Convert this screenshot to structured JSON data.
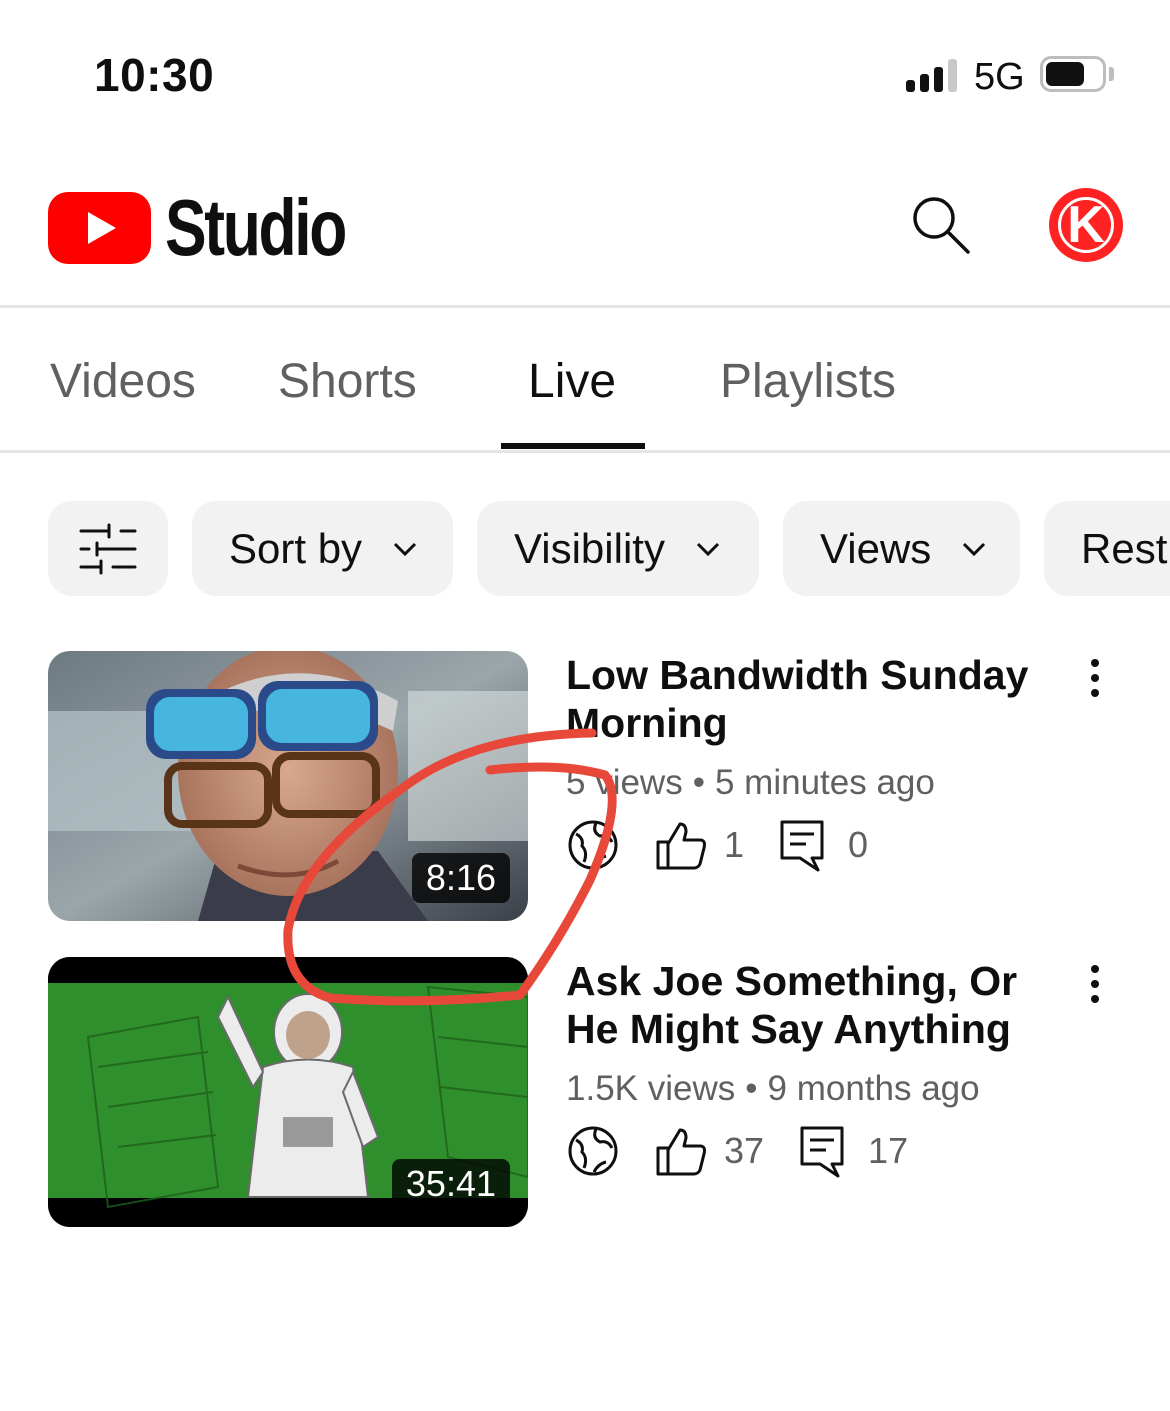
{
  "status_bar": {
    "time": "10:30",
    "network": "5G",
    "battery_level": 0.7
  },
  "header": {
    "logo_text": "Studio",
    "avatar_letter": "K",
    "brand_color": "#ff0000"
  },
  "tabs": [
    {
      "label": "Videos",
      "active": false
    },
    {
      "label": "Shorts",
      "active": false
    },
    {
      "label": "Live",
      "active": true
    },
    {
      "label": "Playlists",
      "active": false
    }
  ],
  "filters": {
    "chips": [
      {
        "label": "Sort by"
      },
      {
        "label": "Visibility"
      },
      {
        "label": "Views"
      },
      {
        "label": "Restr"
      }
    ]
  },
  "videos": [
    {
      "title": "Low Bandwidth Sunday Morning",
      "views": "5 views",
      "age": "5 minutes ago",
      "duration": "8:16",
      "likes": "1",
      "comments": "0",
      "visibility_icon": "globe-icon"
    },
    {
      "title": "Ask Joe Something, Or He Might Say Anything",
      "views": "1.5K views",
      "age": "9 months ago",
      "duration": "35:41",
      "likes": "37",
      "comments": "17",
      "visibility_icon": "globe-icon"
    }
  ],
  "annotation_color": "#e8483a"
}
